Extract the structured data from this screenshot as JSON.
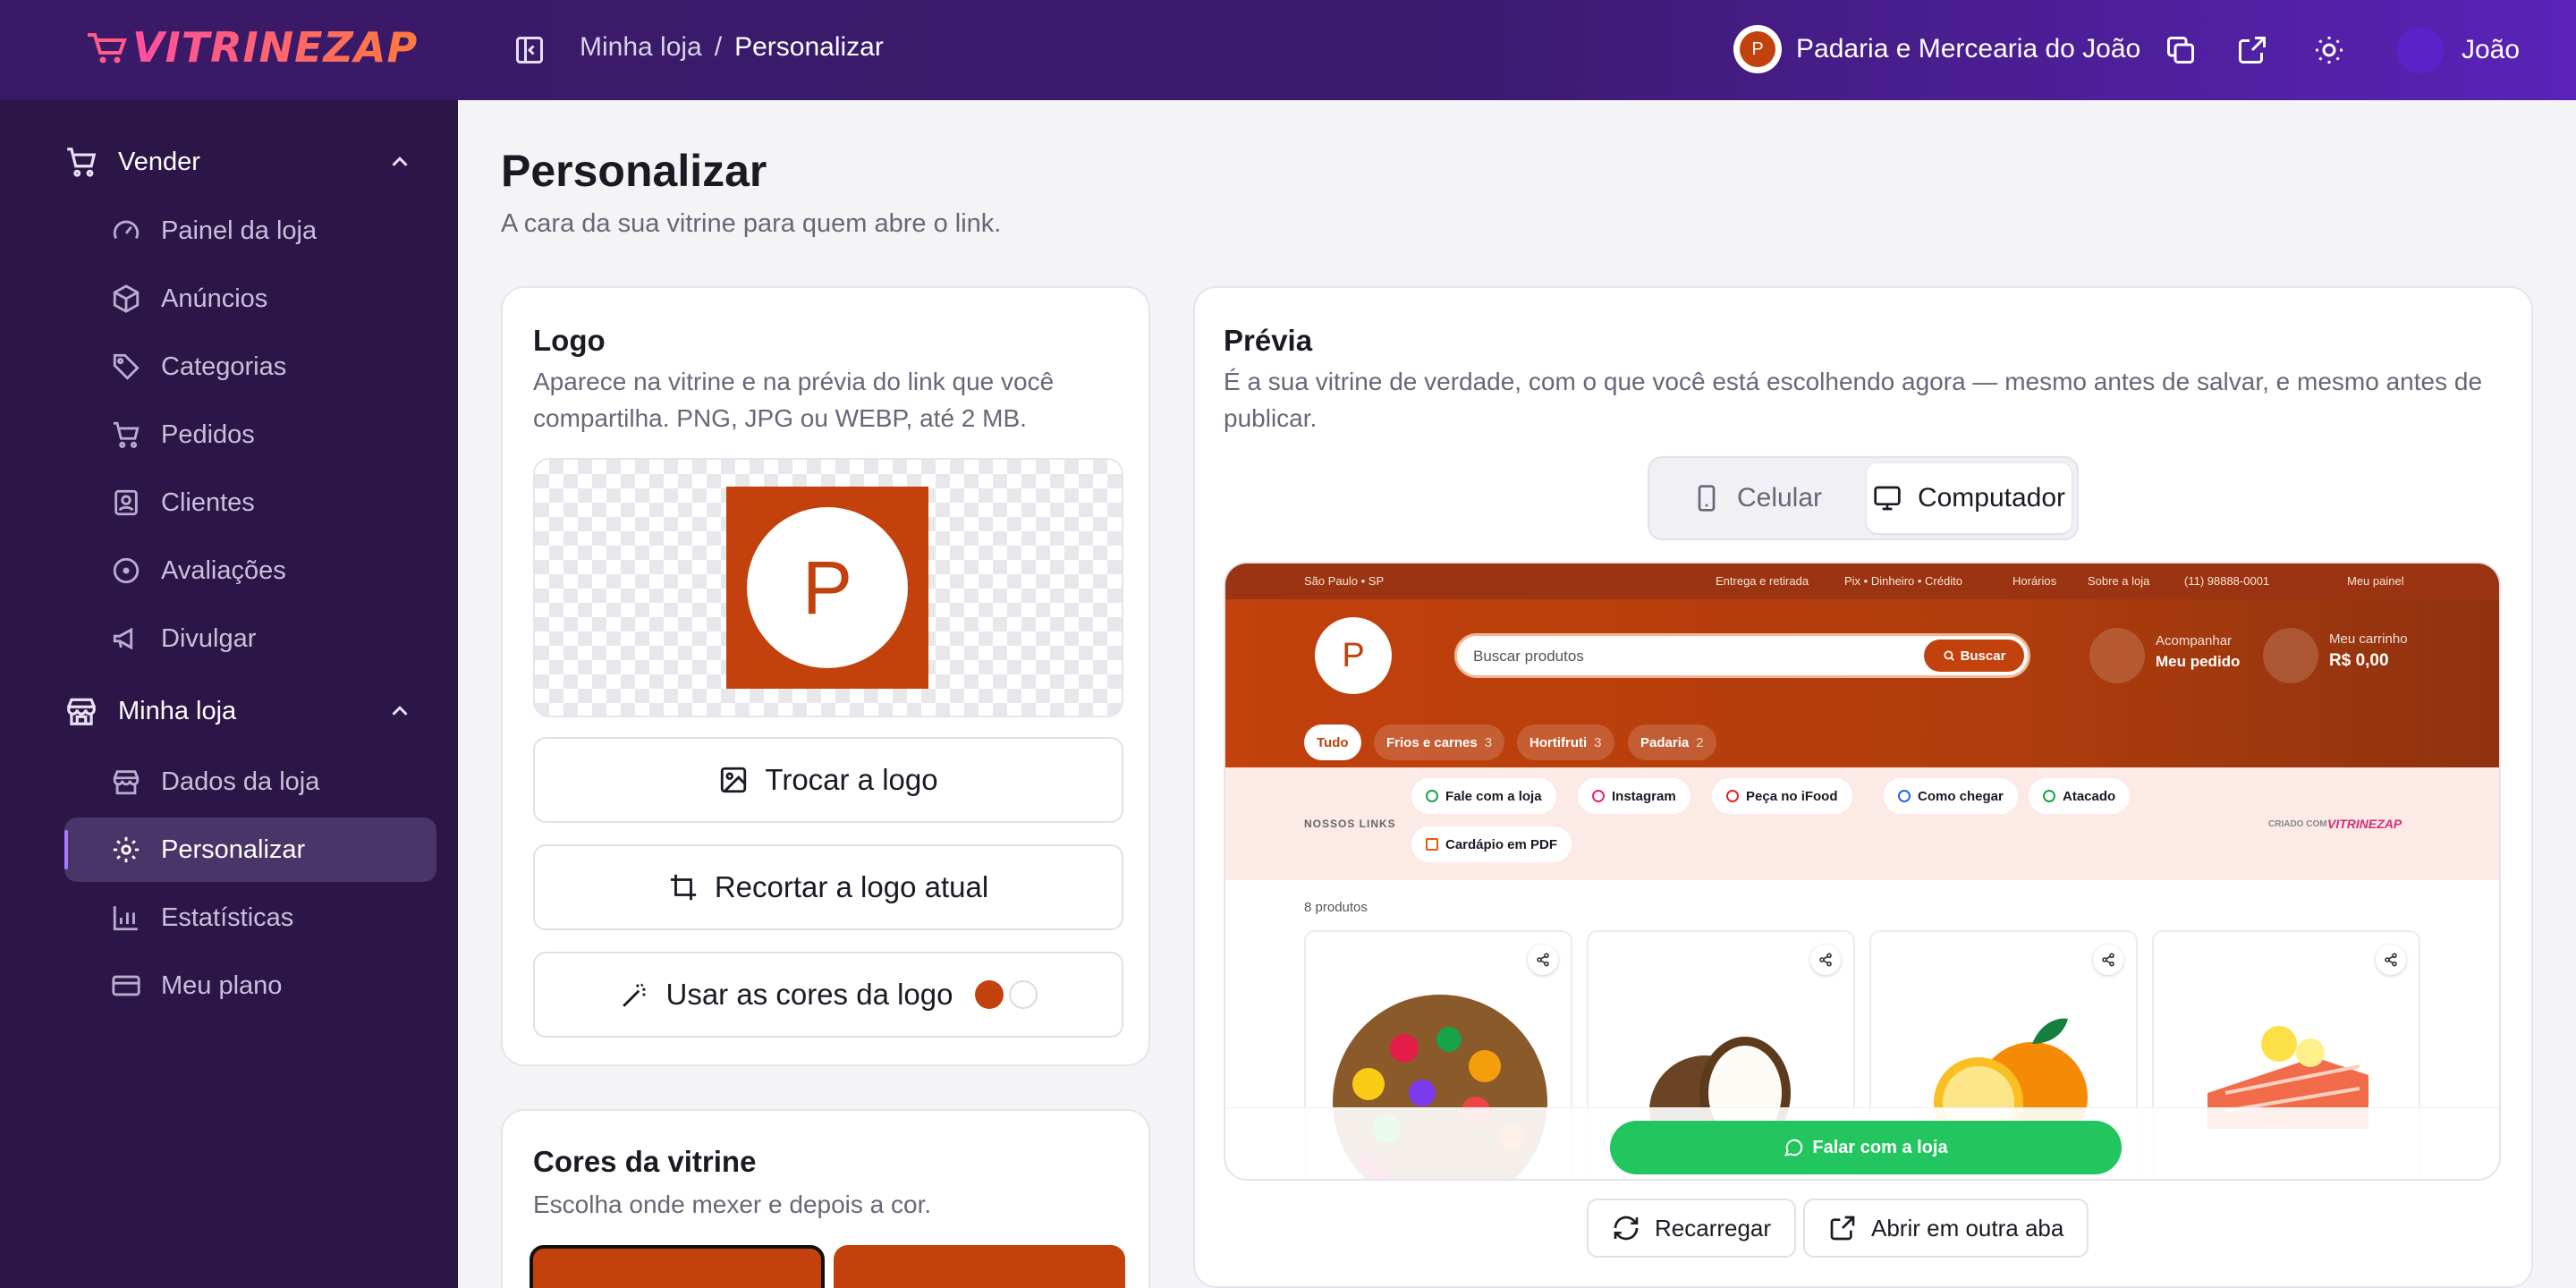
{
  "brand": {
    "logo_text": "VITRINEZAP"
  },
  "header": {
    "breadcrumb": [
      "Minha loja",
      "Personalizar"
    ],
    "store_avatar": "P",
    "store_name": "Padaria e Mercearia do João",
    "user_name": "João"
  },
  "sidebar": {
    "groups": [
      {
        "label": "Vender",
        "icon": "cart-icon",
        "items": [
          {
            "label": "Painel da loja",
            "icon": "gauge-icon"
          },
          {
            "label": "Anúncios",
            "icon": "box-icon"
          },
          {
            "label": "Categorias",
            "icon": "tag-icon"
          },
          {
            "label": "Pedidos",
            "icon": "cart-icon"
          },
          {
            "label": "Clientes",
            "icon": "contact-icon"
          },
          {
            "label": "Avaliações",
            "icon": "circle-dot-icon"
          },
          {
            "label": "Divulgar",
            "icon": "megaphone-icon"
          }
        ]
      },
      {
        "label": "Minha loja",
        "icon": "store-icon",
        "items": [
          {
            "label": "Dados da loja",
            "icon": "store-icon"
          },
          {
            "label": "Personalizar",
            "icon": "gear-icon",
            "active": true
          },
          {
            "label": "Estatísticas",
            "icon": "bar-chart-icon"
          },
          {
            "label": "Meu plano",
            "icon": "credit-card-icon"
          }
        ]
      }
    ]
  },
  "page": {
    "title": "Personalizar",
    "subtitle": "A cara da sua vitrine para quem abre o link."
  },
  "logo_card": {
    "title": "Logo",
    "desc": "Aparece na vitrine e na prévia do link que você compartilha. PNG, JPG ou WEBP, até 2 MB.",
    "logo_letter": "P",
    "change_button": "Trocar a logo",
    "crop_button": "Recortar a logo atual",
    "colors_button": "Usar as cores da logo",
    "logo_colors": [
      "#c2410c",
      "#ffffff"
    ]
  },
  "colors_card": {
    "title": "Cores da vitrine",
    "desc": "Escolha onde mexer e depois a cor.",
    "swatches": [
      "#c2410c",
      "#c2410c"
    ]
  },
  "preview_card": {
    "title": "Prévia",
    "desc": "É a sua vitrine de verdade, com o que você está escolhendo agora — mesmo antes de salvar, e mesmo antes de publicar.",
    "toggle": {
      "mobile": "Celular",
      "desktop": "Computador",
      "selected": "Computador"
    },
    "reload_button": "Recarregar",
    "open_tab_button": "Abrir em outra aba"
  },
  "storefront": {
    "accent": "#c2410c",
    "top": {
      "location": "São Paulo • SP",
      "delivery": "Entrega e retirada",
      "payment": "Pix • Dinheiro • Crédito",
      "hours": "Horários",
      "about": "Sobre a loja",
      "phone": "(11) 98888-0001",
      "panel": "Meu painel"
    },
    "logo_letter": "P",
    "search_placeholder": "Buscar produtos",
    "search_button": "Buscar",
    "order_small": "Acompanhar",
    "order_big": "Meu pedido",
    "cart_small": "Meu carrinho",
    "cart_big": "R$ 0,00",
    "categories": [
      {
        "label": "Tudo",
        "count": ""
      },
      {
        "label": "Frios e carnes",
        "count": "3"
      },
      {
        "label": "Hortifruti",
        "count": "3"
      },
      {
        "label": "Padaria",
        "count": "2"
      }
    ],
    "links_title": "NOSSOS LINKS",
    "links": [
      "Fale com a loja",
      "Instagram",
      "Peça no iFood",
      "Como chegar",
      "Atacado",
      "Cardápio em PDF"
    ],
    "created_with": "CRIADO COM",
    "created_brand": "VITRINEZAP",
    "product_count": "8 produtos",
    "products": [
      "fruit-platter",
      "coconut",
      "orange",
      "salmon"
    ],
    "whatsapp_button": "Falar com a loja"
  }
}
